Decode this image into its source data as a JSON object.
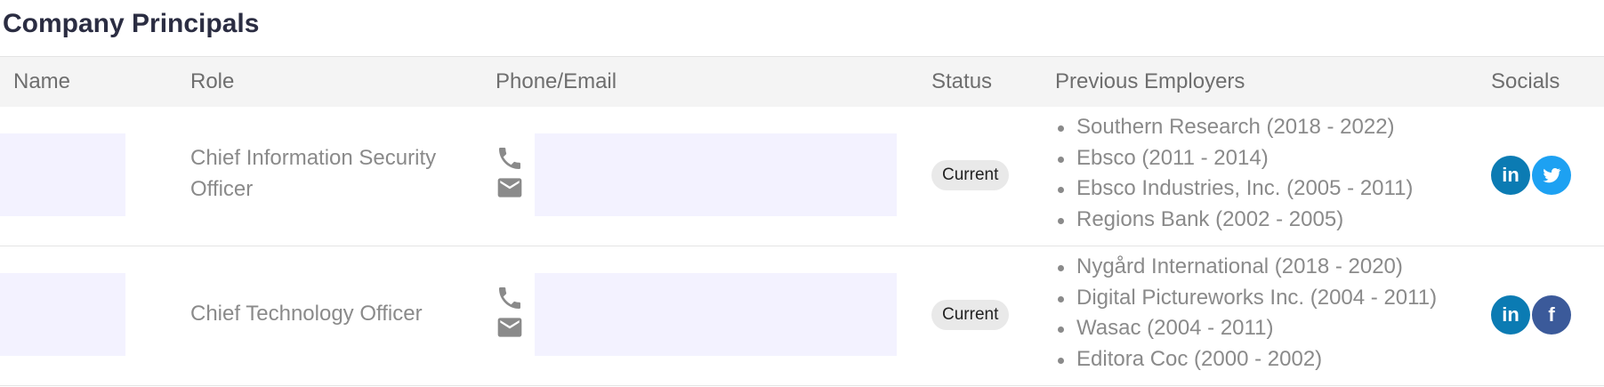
{
  "section_title": "Company Principals",
  "table": {
    "headers": {
      "name": "Name",
      "role": "Role",
      "contact": "Phone/Email",
      "status": "Status",
      "employers": "Previous Employers",
      "socials": "Socials"
    },
    "rows": [
      {
        "role": "Chief Information Security Officer",
        "status": "Current",
        "employers": [
          "Southern Research (2018 - 2022)",
          "Ebsco (2011 - 2014)",
          "Ebsco Industries, Inc. (2005 - 2011)",
          "Regions Bank (2002 - 2005)"
        ],
        "socials": [
          {
            "icon": "linkedin-icon",
            "label": "in",
            "color": "#0b7bb3"
          },
          {
            "icon": "twitter-icon",
            "label": "",
            "color": "#1da1f2"
          }
        ]
      },
      {
        "role": "Chief Technology Officer",
        "status": "Current",
        "employers": [
          "Nygård International (2018 - 2020)",
          "Digital Pictureworks Inc. (2004 - 2011)",
          "Wasac (2004 - 2011)",
          "Editora Coc (2000 - 2002)"
        ],
        "socials": [
          {
            "icon": "linkedin-icon",
            "label": "in",
            "color": "#0b7bb3"
          },
          {
            "icon": "facebook-icon",
            "label": "f",
            "color": "#3b5a9a"
          }
        ]
      }
    ]
  }
}
